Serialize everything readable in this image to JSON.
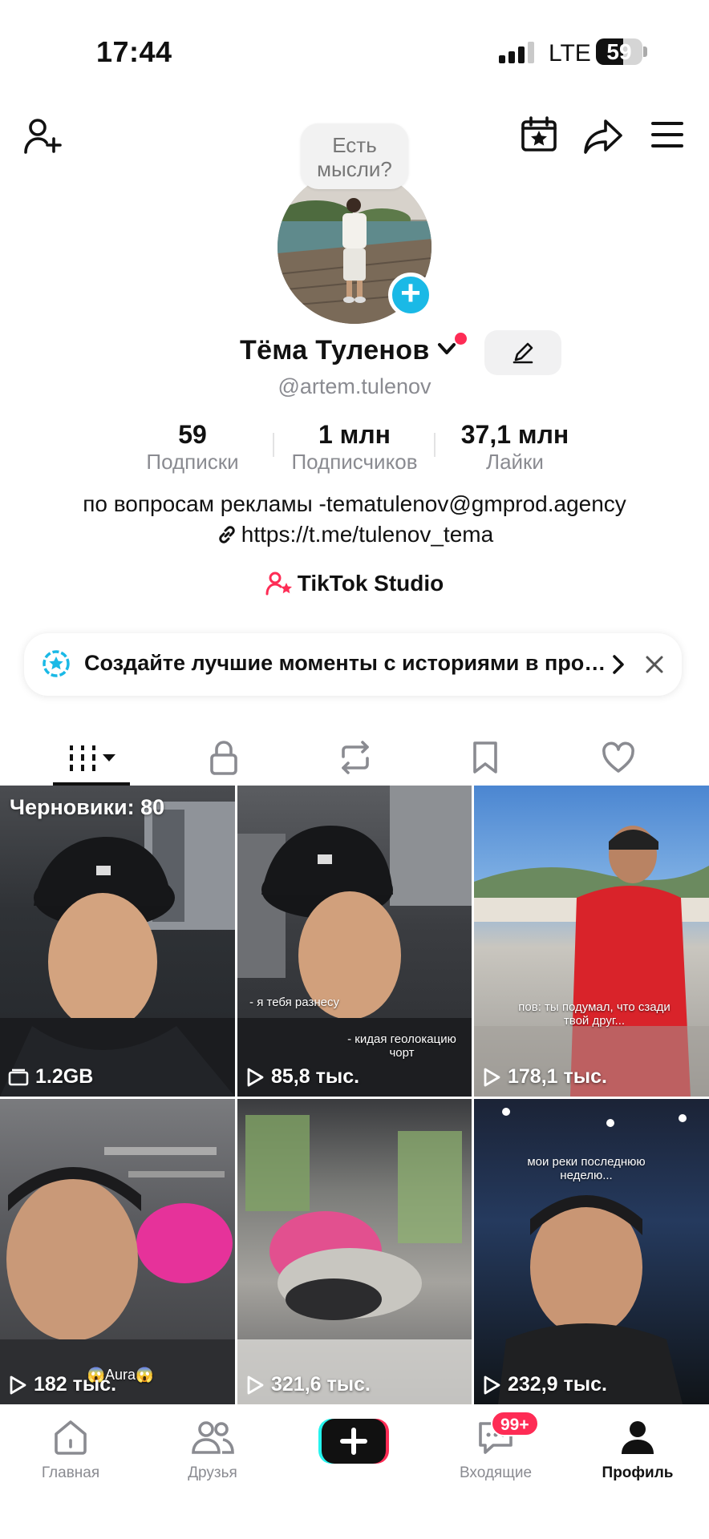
{
  "status_bar": {
    "time": "17:44",
    "network": "LTE",
    "battery": "59",
    "battery_level": 0.59
  },
  "header": {
    "left_icon": "add-friend-icon",
    "right_icons": [
      "calendar-star-icon",
      "share-icon",
      "menu-icon"
    ]
  },
  "profile": {
    "thought_bubble": "Есть мысли?",
    "name": "Тёма  Туленов",
    "handle": "@artem.tulenov",
    "stats": [
      {
        "value": "59",
        "label": "Подписки"
      },
      {
        "value": "1 млн",
        "label": "Подписчиков"
      },
      {
        "value": "37,1 млн",
        "label": "Лайки"
      }
    ],
    "bio": "по вопросам рекламы -tematulenov@gmprod.agency",
    "link": "https://t.me/tulenov_tema",
    "studio": "TikTok Studio"
  },
  "banner": {
    "text": "Создайте лучшие моменты с историями в профиле"
  },
  "tabs": [
    {
      "icon": "grid-icon",
      "active": true
    },
    {
      "icon": "lock-icon",
      "active": false
    },
    {
      "icon": "repost-icon",
      "active": false
    },
    {
      "icon": "bookmark-icon",
      "active": false
    },
    {
      "icon": "heart-icon",
      "active": false
    }
  ],
  "grid": [
    {
      "drafts": "Черновики: 80",
      "count": "1.2GB",
      "count_icon": "folder-icon"
    },
    {
      "count": "85,8 тыс.",
      "count_icon": "play-icon",
      "caption1": "- я тебя разнесу",
      "caption2": "- кидая геолокацию\nчорт"
    },
    {
      "count": "178,1 тыс.",
      "count_icon": "play-icon",
      "caption": "пов: ты подумал, что сзади\nтвой друг..."
    },
    {
      "count": "182 тыс.",
      "count_icon": "play-icon",
      "caption": "😱Aura😱"
    },
    {
      "count": "321,6 тыс.",
      "count_icon": "play-icon"
    },
    {
      "count": "232,9 тыс.",
      "count_icon": "play-icon",
      "caption": "мои реки последнюю\nнеделю..."
    }
  ],
  "bottom_nav": {
    "items": [
      {
        "label": "Главная",
        "icon": "home-icon"
      },
      {
        "label": "Друзья",
        "icon": "friends-icon"
      },
      {
        "label": "",
        "icon": "create-icon"
      },
      {
        "label": "Входящие",
        "icon": "inbox-icon",
        "badge": "99+"
      },
      {
        "label": "Профиль",
        "icon": "profile-icon",
        "active": true
      }
    ]
  },
  "colors": {
    "accent": "#fe2c55",
    "teal": "#1ab9e6",
    "muted": "#8a8b91"
  }
}
